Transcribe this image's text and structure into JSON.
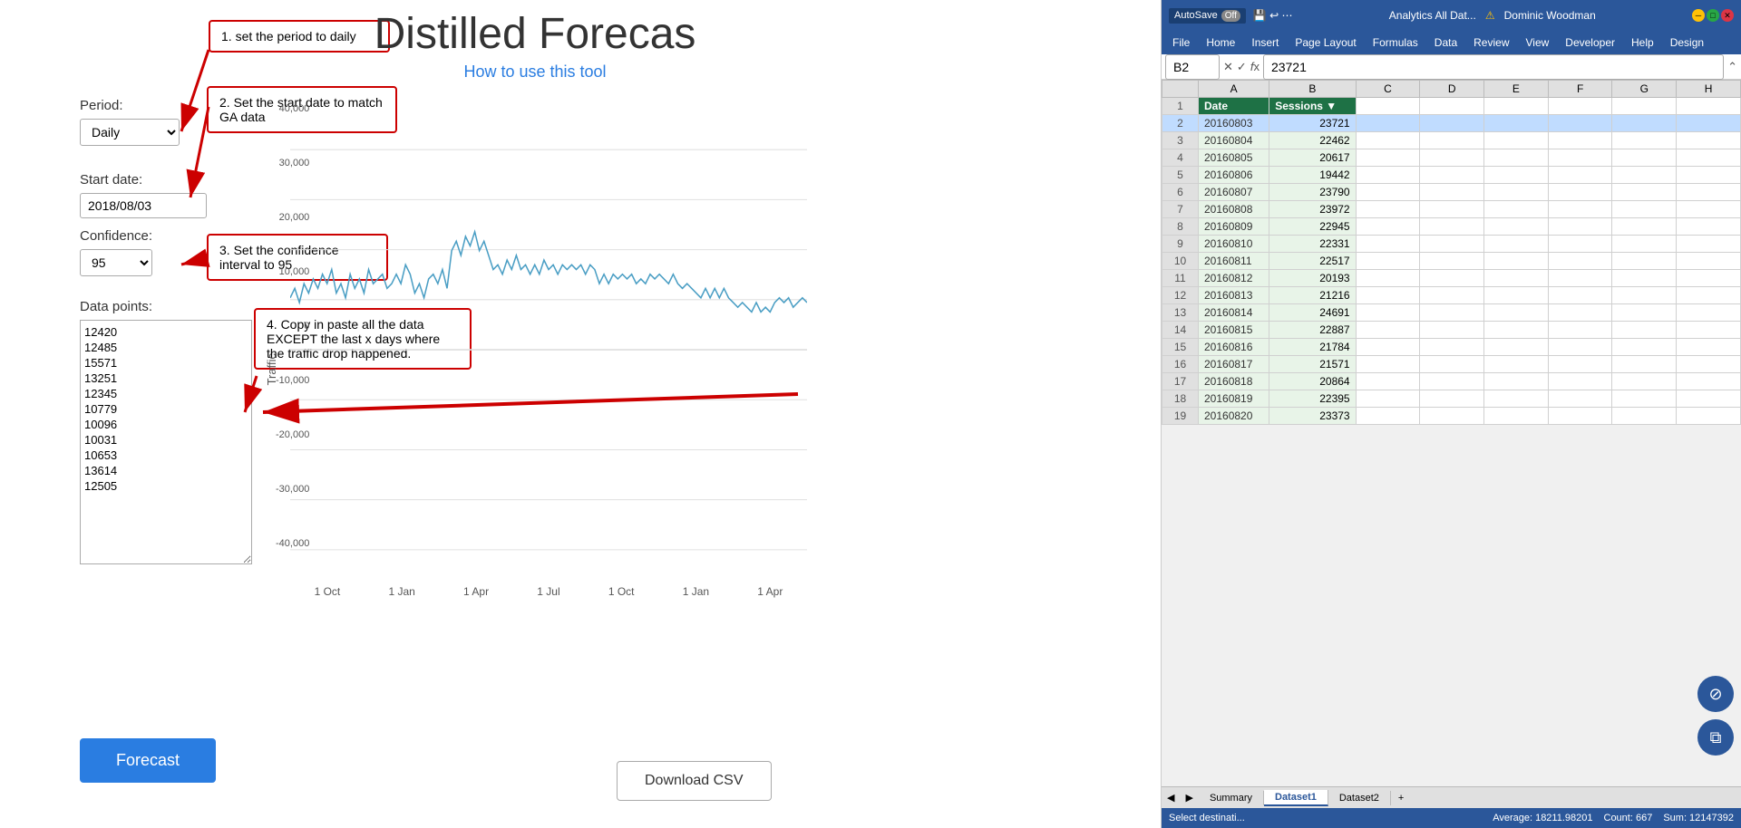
{
  "page": {
    "title": "Distilled Forecas",
    "subtitle": "How to use this tool"
  },
  "callouts": {
    "c1": "1. set the period to daily",
    "c2": "2. Set the start date to match GA data",
    "c3": "3. Set the confidence interval to 95",
    "c4": "4. Copy in paste all the data EXCEPT the last x days where the traffic drop happened."
  },
  "controls": {
    "period_label": "Period:",
    "period_value": "Daily",
    "startdate_label": "Start date:",
    "startdate_value": "2018/08/03",
    "confidence_label": "Confidence:",
    "confidence_value": "95",
    "datapoints_label": "Data points:",
    "datapoints": [
      "12420",
      "12485",
      "15571",
      "13251",
      "12345",
      "10779",
      "10096",
      "10031",
      "10653",
      "13614",
      "12505"
    ]
  },
  "buttons": {
    "forecast": "Forecast",
    "download_csv": "Download CSV"
  },
  "chart": {
    "y_label": "Traffic",
    "x_labels": [
      "1 Oct",
      "1 Jan",
      "1 Apr",
      "1 Jul",
      "1 Oct",
      "1 Jan",
      "1 Apr"
    ]
  },
  "excel": {
    "titlebar": {
      "autosave_label": "AutoSave",
      "toggle_state": "Off",
      "file_title": "Analytics All Dat...",
      "warning_icon": "⚠",
      "user": "Dominic Woodman"
    },
    "ribbon_tabs": [
      "File",
      "Home",
      "Insert",
      "Page Layout",
      "Formulas",
      "Data",
      "Review",
      "View",
      "Developer",
      "Help",
      "Design"
    ],
    "formula_bar": {
      "cell_ref": "B2",
      "value": "23721"
    },
    "columns": {
      "row_header": "",
      "A": "Date",
      "B": "Sessions",
      "C": "C",
      "D": "D",
      "E": "E",
      "F": "F",
      "G": "G",
      "H": "H"
    },
    "rows": [
      {
        "row": 2,
        "date": "20160803",
        "sessions": "23721",
        "selected": true
      },
      {
        "row": 3,
        "date": "20160804",
        "sessions": "22462",
        "selected": false
      },
      {
        "row": 4,
        "date": "20160805",
        "sessions": "20617",
        "selected": false
      },
      {
        "row": 5,
        "date": "20160806",
        "sessions": "19442",
        "selected": false
      },
      {
        "row": 6,
        "date": "20160807",
        "sessions": "23790",
        "selected": false
      },
      {
        "row": 7,
        "date": "20160808",
        "sessions": "23972",
        "selected": false
      },
      {
        "row": 8,
        "date": "20160809",
        "sessions": "22945",
        "selected": false
      },
      {
        "row": 9,
        "date": "20160810",
        "sessions": "22331",
        "selected": false
      },
      {
        "row": 10,
        "date": "20160811",
        "sessions": "22517",
        "selected": false
      },
      {
        "row": 11,
        "date": "20160812",
        "sessions": "20193",
        "selected": false
      },
      {
        "row": 12,
        "date": "20160813",
        "sessions": "21216",
        "selected": false
      },
      {
        "row": 13,
        "date": "20160814",
        "sessions": "24691",
        "selected": false
      },
      {
        "row": 14,
        "date": "20160815",
        "sessions": "22887",
        "selected": false
      },
      {
        "row": 15,
        "date": "20160816",
        "sessions": "21784",
        "selected": false
      },
      {
        "row": 16,
        "date": "20160817",
        "sessions": "21571",
        "selected": false
      },
      {
        "row": 17,
        "date": "20160818",
        "sessions": "20864",
        "selected": false
      },
      {
        "row": 18,
        "date": "20160819",
        "sessions": "22395",
        "selected": false
      },
      {
        "row": 19,
        "date": "20160820",
        "sessions": "23373",
        "selected": false
      }
    ],
    "sheet_tabs": [
      "Summary",
      "Dataset1",
      "Dataset2"
    ],
    "active_sheet": "Dataset1",
    "statusbar": {
      "status": "Select destinati...",
      "average": "Average: 18211.98201",
      "count": "Count: 667",
      "sum": "Sum: 12147392"
    }
  }
}
